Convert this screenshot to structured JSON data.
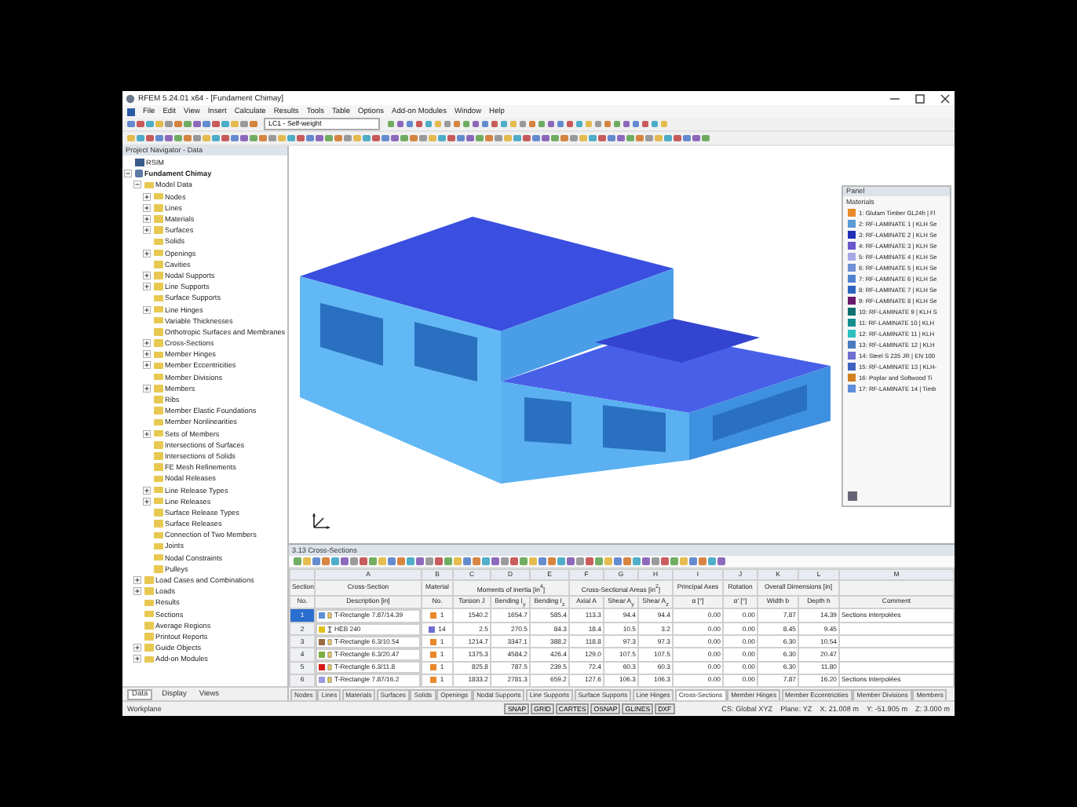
{
  "window": {
    "title": "RFEM 5.24.01 x64 - [Fundament Chimay]"
  },
  "menu": [
    "File",
    "Edit",
    "View",
    "Insert",
    "Calculate",
    "Results",
    "Tools",
    "Table",
    "Options",
    "Add-on Modules",
    "Window",
    "Help"
  ],
  "toolbar": {
    "load_case": "LC1 - Self-weight"
  },
  "navigator": {
    "title": "Project Navigator - Data",
    "tree": [
      {
        "label": "RSIM",
        "kind": "database"
      },
      {
        "label": "Fundament Chimay",
        "kind": "project",
        "active": true,
        "expanded": true,
        "children": [
          {
            "label": "Model Data",
            "kind": "folder",
            "expanded": true,
            "children": [
              {
                "label": "Nodes",
                "kind": "folder",
                "expanded": false
              },
              {
                "label": "Lines",
                "kind": "folder",
                "expanded": false
              },
              {
                "label": "Materials",
                "kind": "folder",
                "expanded": false
              },
              {
                "label": "Surfaces",
                "kind": "folder",
                "expanded": false
              },
              {
                "label": "Solids",
                "kind": "folder"
              },
              {
                "label": "Openings",
                "kind": "folder",
                "expanded": false
              },
              {
                "label": "Cavities",
                "kind": "folder"
              },
              {
                "label": "Nodal Supports",
                "kind": "folder",
                "expanded": false
              },
              {
                "label": "Line Supports",
                "kind": "folder",
                "expanded": false
              },
              {
                "label": "Surface Supports",
                "kind": "folder"
              },
              {
                "label": "Line Hinges",
                "kind": "folder",
                "expanded": false
              },
              {
                "label": "Variable Thicknesses",
                "kind": "folder"
              },
              {
                "label": "Orthotropic Surfaces and Membranes",
                "kind": "folder"
              },
              {
                "label": "Cross-Sections",
                "kind": "folder",
                "expanded": false
              },
              {
                "label": "Member Hinges",
                "kind": "folder",
                "expanded": false
              },
              {
                "label": "Member Eccentricities",
                "kind": "folder",
                "expanded": false
              },
              {
                "label": "Member Divisions",
                "kind": "folder"
              },
              {
                "label": "Members",
                "kind": "folder",
                "expanded": false
              },
              {
                "label": "Ribs",
                "kind": "folder"
              },
              {
                "label": "Member Elastic Foundations",
                "kind": "folder"
              },
              {
                "label": "Member Nonlinearities",
                "kind": "folder"
              },
              {
                "label": "Sets of Members",
                "kind": "folder",
                "expanded": false
              },
              {
                "label": "Intersections of Surfaces",
                "kind": "folder"
              },
              {
                "label": "Intersections of Solids",
                "kind": "folder"
              },
              {
                "label": "FE Mesh Refinements",
                "kind": "folder"
              },
              {
                "label": "Nodal Releases",
                "kind": "folder"
              },
              {
                "label": "Line Release Types",
                "kind": "folder",
                "expanded": false
              },
              {
                "label": "Line Releases",
                "kind": "folder",
                "expanded": false
              },
              {
                "label": "Surface Release Types",
                "kind": "folder"
              },
              {
                "label": "Surface Releases",
                "kind": "folder"
              },
              {
                "label": "Connection of Two Members",
                "kind": "folder"
              },
              {
                "label": "Joints",
                "kind": "folder"
              },
              {
                "label": "Nodal Constraints",
                "kind": "folder"
              },
              {
                "label": "Pulleys",
                "kind": "folder"
              }
            ]
          },
          {
            "label": "Load Cases and Combinations",
            "kind": "folder",
            "expanded": false
          },
          {
            "label": "Loads",
            "kind": "folder",
            "expanded": false
          },
          {
            "label": "Results",
            "kind": "folder"
          },
          {
            "label": "Sections",
            "kind": "folder"
          },
          {
            "label": "Average Regions",
            "kind": "folder"
          },
          {
            "label": "Printout Reports",
            "kind": "folder"
          },
          {
            "label": "Guide Objects",
            "kind": "folder",
            "expanded": false
          },
          {
            "label": "Add-on Modules",
            "kind": "folder",
            "expanded": false
          }
        ]
      }
    ],
    "tabs": [
      {
        "label": "Data",
        "selected": true
      },
      {
        "label": "Display",
        "selected": false
      },
      {
        "label": "Views",
        "selected": false
      }
    ]
  },
  "panel": {
    "title": "Panel",
    "heading": "Materials",
    "items": [
      {
        "label": "1: Glulam Timber GL24h | Fl",
        "color": "#e8892a"
      },
      {
        "label": "2: RF-LAMINATE 1 | KLH Se",
        "color": "#5b9bd5"
      },
      {
        "label": "3: RF-LAMINATE 2 | KLH Se",
        "color": "#1f2fb8"
      },
      {
        "label": "4: RF-LAMINATE 3 | KLH Se",
        "color": "#6a5acd"
      },
      {
        "label": "5: RF-LAMINATE 4 | KLH Se",
        "color": "#a8a8e8"
      },
      {
        "label": "6: RF-LAMINATE 5 | KLH Se",
        "color": "#6d8fd6"
      },
      {
        "label": "7: RF-LAMINATE 6 | KLH Se",
        "color": "#4f83d0"
      },
      {
        "label": "8: RF-LAMINATE 7 | KLH Se",
        "color": "#2e64c0"
      },
      {
        "label": "9: RF-LAMINATE 8 | KLH Se",
        "color": "#6a1a6a"
      },
      {
        "label": "10: RF-LAMINATE 9 | KLH S",
        "color": "#0c6f6f"
      },
      {
        "label": "11: RF-LAMINATE 10 | KLH",
        "color": "#138f8f"
      },
      {
        "label": "12: RF-LAMINATE 11 | KLH",
        "color": "#2bbfbf"
      },
      {
        "label": "13: RF-LAMINATE 12 | KLH",
        "color": "#4a7ac0"
      },
      {
        "label": "14: Steel S 235 JR | EN 100",
        "color": "#6e6ed0"
      },
      {
        "label": "15: RF-LAMINATE 13 | KLH-",
        "color": "#4060c0"
      },
      {
        "label": "16: Poplar and Softwood Ti",
        "color": "#d08020"
      },
      {
        "label": "17: RF-LAMINATE 14 | Timb",
        "color": "#5e8ed8"
      }
    ]
  },
  "table": {
    "title": "3.13 Cross-Sections",
    "groups": [
      {
        "heading": "Section",
        "columns": [
          {
            "label": "No."
          }
        ]
      },
      {
        "heading": "Cross-Section",
        "columns": [
          {
            "letter": "A",
            "label": "Description [in]"
          }
        ]
      },
      {
        "heading": "Material",
        "columns": [
          {
            "letter": "B",
            "label": "No."
          }
        ]
      },
      {
        "heading": "Moments of inertia [in$^{4}$]",
        "columns": [
          {
            "letter": "C",
            "label": "Torsion J"
          },
          {
            "letter": "D",
            "label": "Bending I$_{y}$"
          },
          {
            "letter": "E",
            "label": "Bending I$_{z}$"
          }
        ]
      },
      {
        "heading": "Cross-Sectional Areas [in$^{2}$]",
        "columns": [
          {
            "letter": "F",
            "label": "Axial A"
          },
          {
            "letter": "G",
            "label": "Shear A$_{y}$"
          },
          {
            "letter": "H",
            "label": "Shear A$_{z}$"
          }
        ]
      },
      {
        "heading": "Principal Axes",
        "columns": [
          {
            "letter": "I",
            "label": "α [°]"
          }
        ]
      },
      {
        "heading": "Rotation",
        "columns": [
          {
            "letter": "J",
            "label": "α' [°]"
          }
        ]
      },
      {
        "heading": "Overall Dimensions [in]",
        "columns": [
          {
            "letter": "K",
            "label": "Width b"
          },
          {
            "letter": "L",
            "label": "Depth h"
          }
        ]
      },
      {
        "columns": [
          {
            "letter": "M",
            "label": "Comment"
          }
        ]
      }
    ],
    "rows": [
      {
        "no": "1",
        "selected": true,
        "color": "#5b8fd8",
        "kind": "rectangle",
        "description": "T-Rectangle 7.87/14.39",
        "material": {
          "no": "1",
          "color": "#e8892a"
        },
        "values": [
          "1540.2",
          "1654.7",
          "585.4",
          "113.3",
          "94.4",
          "94.4",
          "0.00",
          "0.00",
          "7.87",
          "14.39"
        ],
        "comment": "Sections interpolées"
      },
      {
        "no": "2",
        "selected": false,
        "color": "#e0c020",
        "kind": "i-section",
        "description": "HEB 240",
        "material": {
          "no": "14",
          "color": "#6e6ed0"
        },
        "values": [
          "2.5",
          "270.5",
          "84.3",
          "18.4",
          "10.5",
          "3.2",
          "0.00",
          "0.00",
          "8.45",
          "9.45"
        ]
      },
      {
        "no": "3",
        "selected": false,
        "color": "#9a6a40",
        "kind": "rectangle",
        "description": "T-Rectangle 6.3/10.54",
        "material": {
          "no": "1",
          "color": "#e8892a"
        },
        "values": [
          "1214.7",
          "3347.1",
          "388.2",
          "118.8",
          "97.3",
          "97.3",
          "0.00",
          "0.00",
          "6.30",
          "10.54"
        ]
      },
      {
        "no": "4",
        "selected": false,
        "color": "#7ab040",
        "kind": "rectangle",
        "description": "T-Rectangle 6.3/20.47",
        "material": {
          "no": "1",
          "color": "#e8892a"
        },
        "values": [
          "1375.3",
          "4584.2",
          "426.4",
          "129.0",
          "107.5",
          "107.5",
          "0.00",
          "0.00",
          "6.30",
          "20.47"
        ]
      },
      {
        "no": "5",
        "selected": false,
        "color": "#d81818",
        "kind": "rectangle",
        "description": "T-Rectangle 6.3/11.8",
        "material": {
          "no": "1",
          "color": "#e8892a"
        },
        "values": [
          "825.8",
          "787.5",
          "239.5",
          "72.4",
          "60.3",
          "60.3",
          "0.00",
          "0.00",
          "6.30",
          "11.80"
        ]
      },
      {
        "no": "6",
        "selected": false,
        "color": "#9a9ae0",
        "kind": "rectangle",
        "description": "T-Rectangle 7.87/16.2",
        "material": {
          "no": "1",
          "color": "#e8892a"
        },
        "values": [
          "1833.2",
          "2781.3",
          "659.2",
          "127.6",
          "106.3",
          "106.3",
          "0.00",
          "0.00",
          "7.87",
          "16.20"
        ],
        "comment": "Sections interpolées"
      }
    ],
    "tabs": [
      {
        "label": "Nodes",
        "selected": false
      },
      {
        "label": "Lines",
        "selected": false
      },
      {
        "label": "Materials",
        "selected": false
      },
      {
        "label": "Surfaces",
        "selected": false
      },
      {
        "label": "Solids",
        "selected": false
      },
      {
        "label": "Openings",
        "selected": false
      },
      {
        "label": "Nodal Supports",
        "selected": false
      },
      {
        "label": "Line Supports",
        "selected": false
      },
      {
        "label": "Surface Supports",
        "selected": false
      },
      {
        "label": "Line Hinges",
        "selected": false
      },
      {
        "label": "Cross-Sections",
        "selected": true
      },
      {
        "label": "Member Hinges",
        "selected": false
      },
      {
        "label": "Member Eccentricities",
        "selected": false
      },
      {
        "label": "Member Divisions",
        "selected": false
      },
      {
        "label": "Members",
        "selected": false
      }
    ]
  },
  "status_bar": {
    "left": "Workplane",
    "toggles": [
      "SNAP",
      "GRID",
      "CARTES",
      "OSNAP",
      "GLINES",
      "DXF"
    ],
    "cs": "CS: Global XYZ",
    "plane": "Plane: YZ",
    "x": "X: 21.008 m",
    "y": "Y: -51.905 m",
    "z": "Z: 3.000 m"
  }
}
